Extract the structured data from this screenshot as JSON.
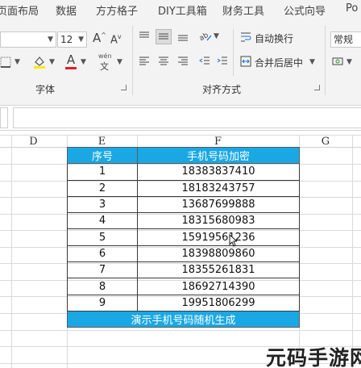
{
  "tabs": [
    "页面布局",
    "数据",
    "方方格子",
    "DIY工具箱",
    "财务工具",
    "公式向导",
    "Po"
  ],
  "ribbon": {
    "font_size": "12",
    "font_size_grow": "A",
    "font_size_shrink": "A",
    "font_color_letter": "A",
    "fill_color_letter": "A",
    "pinyin_label": "wén",
    "group_font_label": "字体",
    "group_align_label": "对齐方式",
    "wrap_text_label": "自动换行",
    "merge_center_label": "合并后居中",
    "number_format_value": "常规",
    "fill_color": "#ffe600",
    "font_color": "#e02020"
  },
  "sheet": {
    "columns": [
      "D",
      "E",
      "F",
      "G"
    ],
    "table_header": [
      "序号",
      "手机号码加密"
    ],
    "rows": [
      [
        "1",
        "18383837410"
      ],
      [
        "2",
        "18183243757"
      ],
      [
        "3",
        "13687699888"
      ],
      [
        "4",
        "18315680983"
      ],
      [
        "5",
        "15919561236"
      ],
      [
        "6",
        "18398809860"
      ],
      [
        "7",
        "18355261831"
      ],
      [
        "8",
        "18692714390"
      ],
      [
        "9",
        "19951806299"
      ]
    ],
    "footer": "演示手机号码随机生成",
    "accent": "#1aa8e4"
  },
  "watermark": "元码手游网"
}
